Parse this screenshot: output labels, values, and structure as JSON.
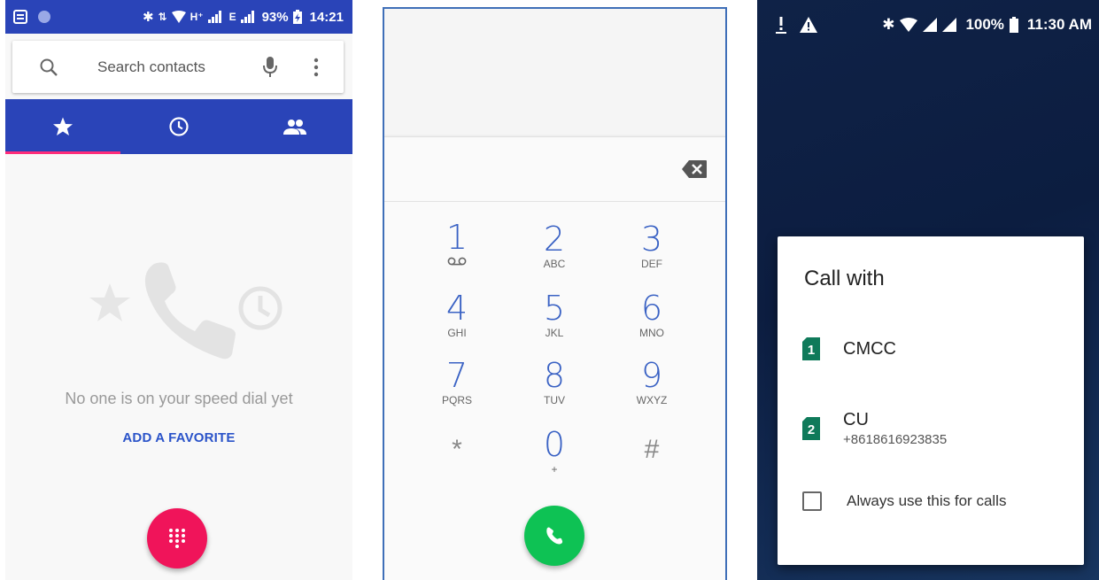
{
  "panel1": {
    "status": {
      "signal_types": "H⁺",
      "signal_type_2": "E",
      "battery": "93%",
      "time": "14:21"
    },
    "search": {
      "placeholder": "Search contacts"
    },
    "tabs": [
      {
        "icon": "star-icon"
      },
      {
        "icon": "clock-icon"
      },
      {
        "icon": "people-icon"
      }
    ],
    "empty_message": "No one is on your speed dial yet",
    "add_favorite": "ADD A FAVORITE",
    "colors": {
      "primary": "#2a44b8",
      "accent": "#f0145a",
      "link": "#2a53c9"
    }
  },
  "panel2": {
    "keys": [
      {
        "num": "1",
        "sub": ""
      },
      {
        "num": "2",
        "sub": "ABC"
      },
      {
        "num": "3",
        "sub": "DEF"
      },
      {
        "num": "4",
        "sub": "GHI"
      },
      {
        "num": "5",
        "sub": "JKL"
      },
      {
        "num": "6",
        "sub": "MNO"
      },
      {
        "num": "7",
        "sub": "PQRS"
      },
      {
        "num": "8",
        "sub": "TUV"
      },
      {
        "num": "9",
        "sub": "WXYZ"
      },
      {
        "num": "*",
        "sub": ""
      },
      {
        "num": "0",
        "sub": "+"
      },
      {
        "num": "#",
        "sub": ""
      }
    ],
    "colors": {
      "digit": "#3a62c4",
      "call": "#0ec254"
    }
  },
  "panel3": {
    "status": {
      "battery": "100%",
      "time": "11:30 AM"
    },
    "dialog_title": "Call with",
    "sims": [
      {
        "slot": "1",
        "name": "CMCC",
        "number": ""
      },
      {
        "slot": "2",
        "name": "CU",
        "number": "+8618616923835"
      }
    ],
    "always_label": "Always use this for calls",
    "colors": {
      "sim_badge": "#0f7a5a"
    }
  }
}
